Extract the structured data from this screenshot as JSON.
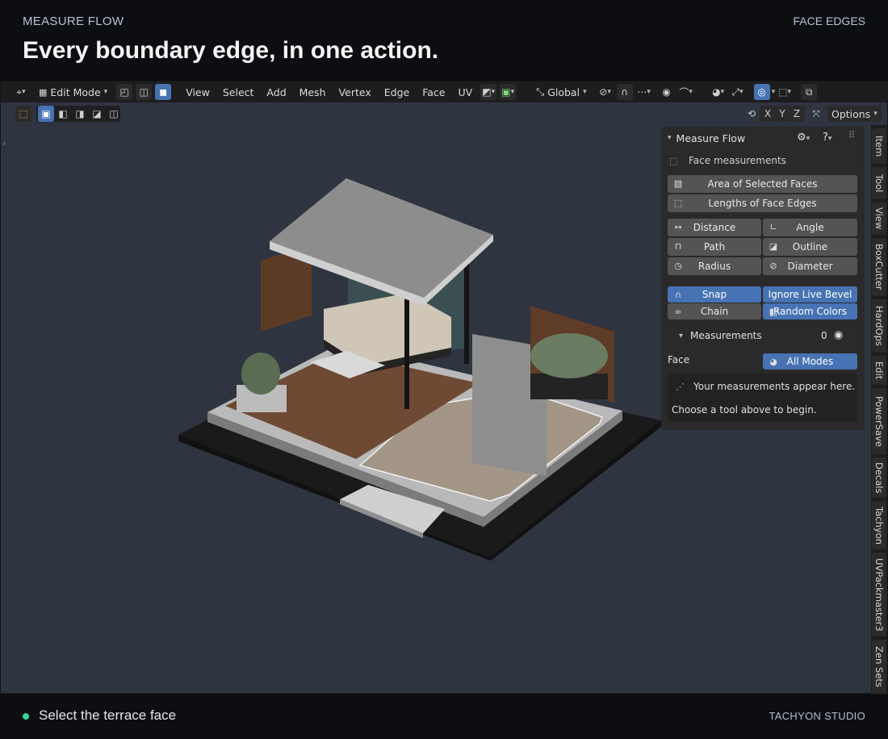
{
  "header": {
    "eyebrow": "MEASURE FLOW",
    "eyebrow_right": "FACE EDGES",
    "headline": "Every boundary edge, in one action."
  },
  "toolbar": {
    "mode": "Edit Mode",
    "menus": [
      "View",
      "Select",
      "Add",
      "Mesh",
      "Vertex",
      "Edge",
      "Face",
      "UV"
    ],
    "transform_orientation": "Global",
    "axes": [
      "X",
      "Y",
      "Z"
    ],
    "options_label": "Options"
  },
  "panel": {
    "title": "Measure Flow",
    "section_label": "Face measurements",
    "face_buttons": [
      "Area of Selected Faces",
      "Lengths of Face Edges"
    ],
    "tools": [
      "Distance",
      "Angle",
      "Path",
      "Outline",
      "Radius",
      "Diameter"
    ],
    "snap_label": "Snap",
    "ignore_live_bevel_label": "Ignore Live Bevel",
    "chain_label": "Chain",
    "random_colors_label": "Random Colors",
    "measurements_label": "Measurements",
    "measurements_count": "0",
    "face_label": "Face",
    "all_modes_label": "All Modes",
    "hint_line1": "Your measurements appear here.",
    "hint_line2": "Choose a tool above to begin."
  },
  "sidebar_tabs": [
    "Item",
    "Tool",
    "View",
    "BoxCutter",
    "HardOps",
    "Edit",
    "PowerSave",
    "Decals",
    "Tachyon",
    "UVPackmaster3",
    "Zen Sets"
  ],
  "footer": {
    "status": "Select the terrace face",
    "brand": "TACHYON STUDIO"
  },
  "colors": {
    "accent": "#4772b3",
    "status_dot": "#35d49a",
    "viewport_bg": "#2e3440"
  }
}
